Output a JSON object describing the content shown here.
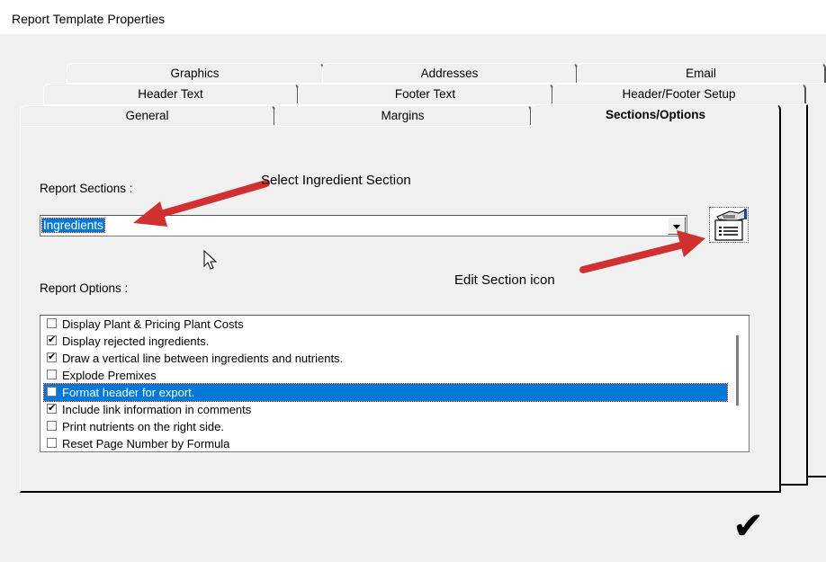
{
  "window": {
    "title": "Report Template Properties"
  },
  "tabs": {
    "row1": [
      "Graphics",
      "Addresses",
      "Email"
    ],
    "row2": [
      "Header Text",
      "Footer Text",
      "Header/Footer Setup"
    ],
    "row3": [
      "General",
      "Margins",
      "Sections/Options"
    ],
    "active": "Sections/Options"
  },
  "report_sections": {
    "label": "Report Sections :",
    "selected": "Ingredients"
  },
  "report_options": {
    "label": "Report Options :",
    "items": [
      {
        "label": "Display Plant & Pricing Plant Costs",
        "checked": false,
        "selected": false
      },
      {
        "label": "Display rejected ingredients.",
        "checked": true,
        "selected": false
      },
      {
        "label": "Draw a vertical line between ingredients and nutrients.",
        "checked": true,
        "selected": false
      },
      {
        "label": "Explode Premixes",
        "checked": false,
        "selected": false
      },
      {
        "label": "Format header for export.",
        "checked": false,
        "selected": true
      },
      {
        "label": "Include link information in comments",
        "checked": true,
        "selected": false
      },
      {
        "label": "Print nutrients on the right side.",
        "checked": false,
        "selected": false
      },
      {
        "label": "Reset Page Number by Formula",
        "checked": false,
        "selected": false
      }
    ]
  },
  "annotations": {
    "select_section": "Select Ingredient Section",
    "edit_icon": "Edit Section icon"
  },
  "icons": {
    "edit_section": "edit-section-icon",
    "ok": "checkmark-icon",
    "cursor": "mouse-pointer-icon"
  },
  "colors": {
    "selection": "#0078d7",
    "arrow": "#e53935"
  }
}
